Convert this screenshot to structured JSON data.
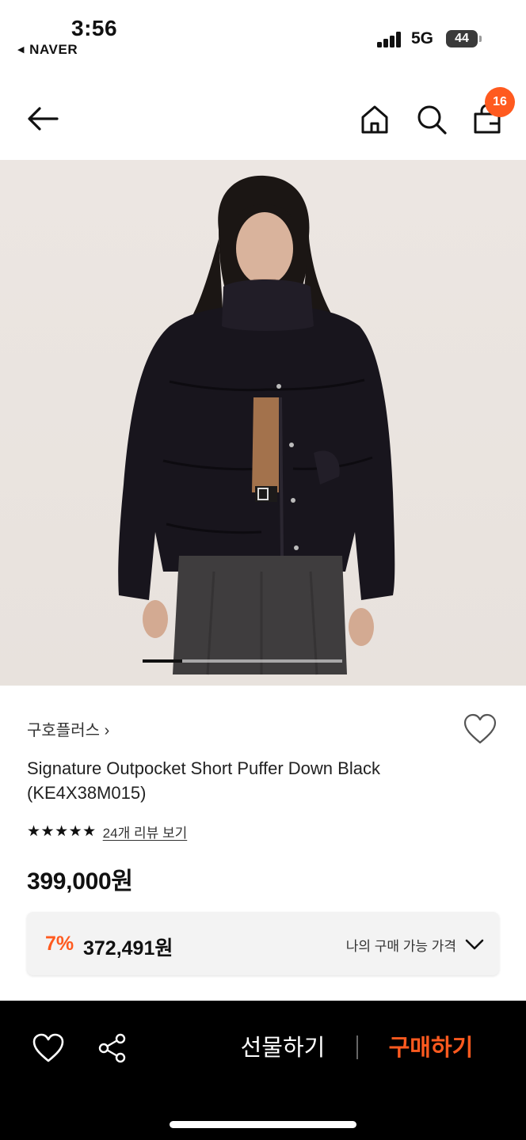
{
  "status_bar": {
    "time": "3:56",
    "back_app": "NAVER",
    "network": "5G",
    "battery": "44"
  },
  "header": {
    "cart_count": "16",
    "icons": [
      "back-arrow-icon",
      "home-icon",
      "search-icon",
      "cart-icon"
    ]
  },
  "gallery": {
    "image_description_colors": {
      "background": "#e9e3de",
      "jacket": "#17141c",
      "skirt": "#3f3d3e"
    },
    "position_fraction": 0.2
  },
  "product": {
    "brand": "구호플러스",
    "brand_chevron": "›",
    "title": "Signature Outpocket Short Puffer Down  Black (KE4X38M015)",
    "rating_stars": 5,
    "stars_text": "★★★★★",
    "review_link": "24개 리뷰 보기",
    "price": "399,000원"
  },
  "discount": {
    "rate": "7%",
    "price": "372,491원",
    "my_price_label": "나의 구매 가능 가격"
  },
  "bottom_bar": {
    "gift_label": "선물하기",
    "buy_label": "구매하기"
  },
  "colors": {
    "accent": "#ff5a1f",
    "bottom_bar": "#000000",
    "discount_box": "#f3f3f3"
  }
}
